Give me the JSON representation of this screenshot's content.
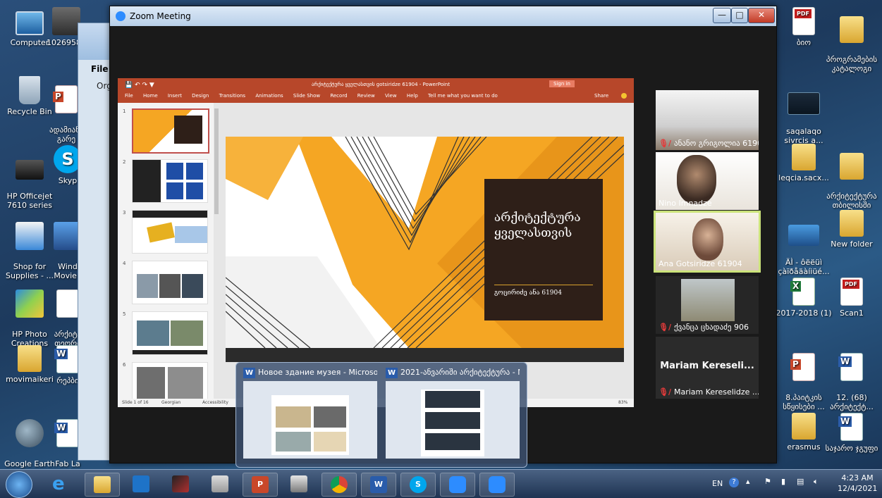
{
  "desktop": {
    "left_icons": [
      {
        "label": "Computer",
        "icon": "computer-icon"
      },
      {
        "label": "10269581",
        "icon": "user-icon"
      },
      {
        "label": "Recycle Bin",
        "icon": "recycle-bin-icon"
      },
      {
        "label": "ადამიანი\nგარე",
        "icon": "powerpoint-file-icon"
      },
      {
        "label": "HP Officejet\n7610 series",
        "icon": "printer-icon"
      },
      {
        "label": "Skyp",
        "icon": "skype-icon"
      },
      {
        "label": "Shop for\nSupplies - ...",
        "icon": "shop-icon"
      },
      {
        "label": "Wind\nMovie I",
        "icon": "movie-maker-icon"
      },
      {
        "label": "HP Photo\nCreations",
        "icon": "photo-icon"
      },
      {
        "label": "არქიტე\nთეორი",
        "icon": "document-icon"
      },
      {
        "label": "movimaikeri",
        "icon": "folder-icon"
      },
      {
        "label": "რეპბი",
        "icon": "word-file-icon"
      },
      {
        "label": "Google Earth\nPro",
        "icon": "google-earth-icon"
      },
      {
        "label": "Fab La\nბარე",
        "icon": "word-file-icon"
      }
    ],
    "right_icons": [
      {
        "label": "ბიო",
        "icon": "pdf-file-icon"
      },
      {
        "label": "პროგრამების\nკატალოგი",
        "icon": "folder-icon"
      },
      {
        "label": "saqalaqo\nsivrcis a...",
        "icon": "presentation-icon"
      },
      {
        "label": "leqcia.sacx...",
        "icon": "folder-icon"
      },
      {
        "label": "არქიტექტურა\nთბილისში",
        "icon": "folder-icon"
      },
      {
        "label": "ÄÌ - ôëëüì\nçàïðåäàíiüé...",
        "icon": "video-file-icon"
      },
      {
        "label": "New folder",
        "icon": "folder-icon"
      },
      {
        "label": "2017-2018 (1)",
        "icon": "excel-file-icon"
      },
      {
        "label": "Scan1",
        "icon": "pdf-file-icon"
      },
      {
        "label": "8.პაიტკის\nსწყისები ...",
        "icon": "powerpoint-file-icon"
      },
      {
        "label": "12. (68)\nარქიტექტ...",
        "icon": "word-file-icon"
      },
      {
        "label": "erasmus",
        "icon": "folder-icon"
      },
      {
        "label": "საჯარო ჯგუფი",
        "icon": "word-file-icon"
      }
    ]
  },
  "explorer": {
    "file_menu": "File",
    "organize": "Org"
  },
  "zoom": {
    "title": "Zoom Meeting",
    "ppt": {
      "doc_title": "არქიტექტურა ყველასთვის gotsiridze 61904 - PowerPoint",
      "sign_in": "Sign in",
      "share": "Share",
      "menu": [
        "File",
        "Home",
        "Insert",
        "Design",
        "Transitions",
        "Animations",
        "Slide Show",
        "Record",
        "Review",
        "View",
        "Help",
        "Tell me what you want to do"
      ],
      "thumb_numbers": [
        "1",
        "2",
        "3",
        "4",
        "5",
        "6"
      ],
      "status": {
        "slide": "Slide 1 of 16",
        "lang": "Georgian",
        "acc": "Accessibility",
        "zoom": "83%"
      },
      "slide_title": "არქიტექტურა ყველასთვის",
      "slide_subtitle": "გოცირიძე ანა 61904"
    },
    "participants": [
      {
        "name": "ანანო გრიგოლია 61905",
        "muted": true
      },
      {
        "name": "Nino Imnadze",
        "muted": false
      },
      {
        "name": "Ana Gotsiridze 61904",
        "muted": false
      },
      {
        "name": "ქვანცა ცხადაძე 906",
        "muted": true
      },
      {
        "name": "Mariam Kereselidze ...",
        "muted": true,
        "big_label": "Mariam Kereseli..."
      }
    ]
  },
  "preview": {
    "items": [
      {
        "title": "Новое здание музея - Microsof..."
      },
      {
        "title": "2021-ანვარიში არქიტექტურა - Mic..."
      }
    ]
  },
  "taskbar": {
    "lang": "EN",
    "time": "4:23 AM",
    "date": "12/4/2021"
  },
  "colors": {
    "ppt_accent": "#b7472a",
    "slide_orange": "#f5a623",
    "slide_dark": "#2e1f18",
    "zoom_blue": "#2d8cff",
    "active_speaker": "#cbe37a"
  }
}
